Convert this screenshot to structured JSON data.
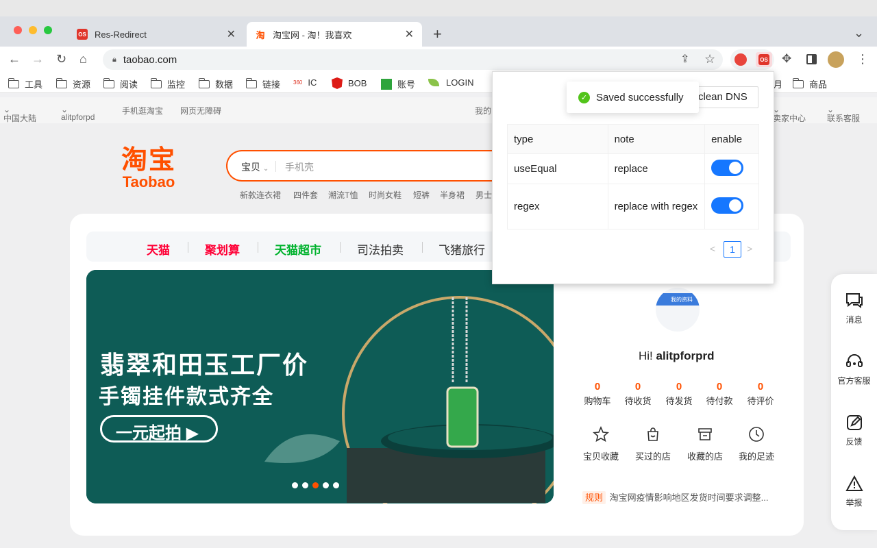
{
  "browser": {
    "tabs": [
      {
        "title": "Res-Redirect",
        "favicon": "redirect-extension-icon",
        "active": false
      },
      {
        "title": "淘宝网 - 淘！我喜欢",
        "favicon": "taobao-icon",
        "active": true
      }
    ],
    "new_tab": "+",
    "tab_menu": "⌄",
    "url": "taobao.com",
    "bookmarks": [
      {
        "label": "工具",
        "icon": "folder-icon"
      },
      {
        "label": "资源",
        "icon": "folder-icon"
      },
      {
        "label": "阅读",
        "icon": "folder-icon"
      },
      {
        "label": "监控",
        "icon": "folder-icon"
      },
      {
        "label": "数据",
        "icon": "folder-icon"
      },
      {
        "label": "链接",
        "icon": "folder-icon"
      },
      {
        "label": "IC",
        "icon": "360-icon"
      },
      {
        "label": "BOB",
        "icon": "angular-icon"
      },
      {
        "label": "账号",
        "icon": "td-icon"
      },
      {
        "label": "LOGIN",
        "icon": "leaf-icon"
      },
      {
        "label": "月",
        "icon": ""
      },
      {
        "label": "商品",
        "icon": "folder-icon"
      }
    ],
    "icon_360_text": "360"
  },
  "site_nav": {
    "region": "中国大陆",
    "user": "alitpforpd",
    "mobile": "手机逛淘宝",
    "accessibility": "网页无障碍",
    "my": "我的",
    "seller_center": "卖家中心",
    "contact": "联系客服"
  },
  "taobao": {
    "logo_cn": "淘宝",
    "logo_en": "Taobao",
    "search_scope": "宝贝",
    "search_placeholder": "手机壳",
    "hot_words": [
      "新款连衣裙",
      "四件套",
      "潮流T恤",
      "时尚女鞋",
      "短裤",
      "半身裙",
      "男士"
    ],
    "channels": [
      {
        "label": "天猫",
        "color": "#ff0036"
      },
      {
        "label": "聚划算",
        "color": "#ff0036"
      },
      {
        "label": "天猫超市",
        "color": "#00b22d"
      },
      {
        "label": "司法拍卖",
        "color": "#333333"
      },
      {
        "label": "飞猪旅行",
        "color": "#333333"
      }
    ],
    "banner": {
      "line1": "翡翠和田玉工厂价",
      "line2": "手镯挂件款式齐全",
      "cta": "一元起拍"
    },
    "user": {
      "greeting_prefix": "Hi! ",
      "name": "alitpforprd",
      "avatar_caption": "我的资料",
      "stats": [
        {
          "value": "0",
          "label": "购物车"
        },
        {
          "value": "0",
          "label": "待收货"
        },
        {
          "value": "0",
          "label": "待发货"
        },
        {
          "value": "0",
          "label": "待付款"
        },
        {
          "value": "0",
          "label": "待评价"
        }
      ],
      "quick_links": [
        {
          "label": "宝贝收藏",
          "icon": "star-icon"
        },
        {
          "label": "买过的店",
          "icon": "bag-icon"
        },
        {
          "label": "收藏的店",
          "icon": "shop-icon"
        },
        {
          "label": "我的足迹",
          "icon": "clock-icon"
        }
      ],
      "notice_tag": "规则",
      "notice_text": "淘宝网疫情影响地区发货时间要求调整..."
    },
    "right_bar": [
      {
        "label": "消息",
        "icon": "chat-icon"
      },
      {
        "label": "官方客服",
        "icon": "headset-icon"
      },
      {
        "label": "反馈",
        "icon": "edit-icon"
      },
      {
        "label": "举报",
        "icon": "warning-icon"
      }
    ]
  },
  "popup": {
    "clean_button": "clean DNS",
    "toast": "Saved successfully",
    "columns": [
      "type",
      "note",
      "enable"
    ],
    "rows": [
      {
        "type": "useEqual",
        "note": "replace",
        "enable": true
      },
      {
        "type": "regex",
        "note": "replace with regex",
        "enable": true
      }
    ],
    "pagination": {
      "current": "1",
      "prev": "<",
      "next": ">"
    }
  },
  "colors": {
    "taobao_orange": "#ff5000",
    "toggle_blue": "#1677ff",
    "success_green": "#52c41a"
  }
}
